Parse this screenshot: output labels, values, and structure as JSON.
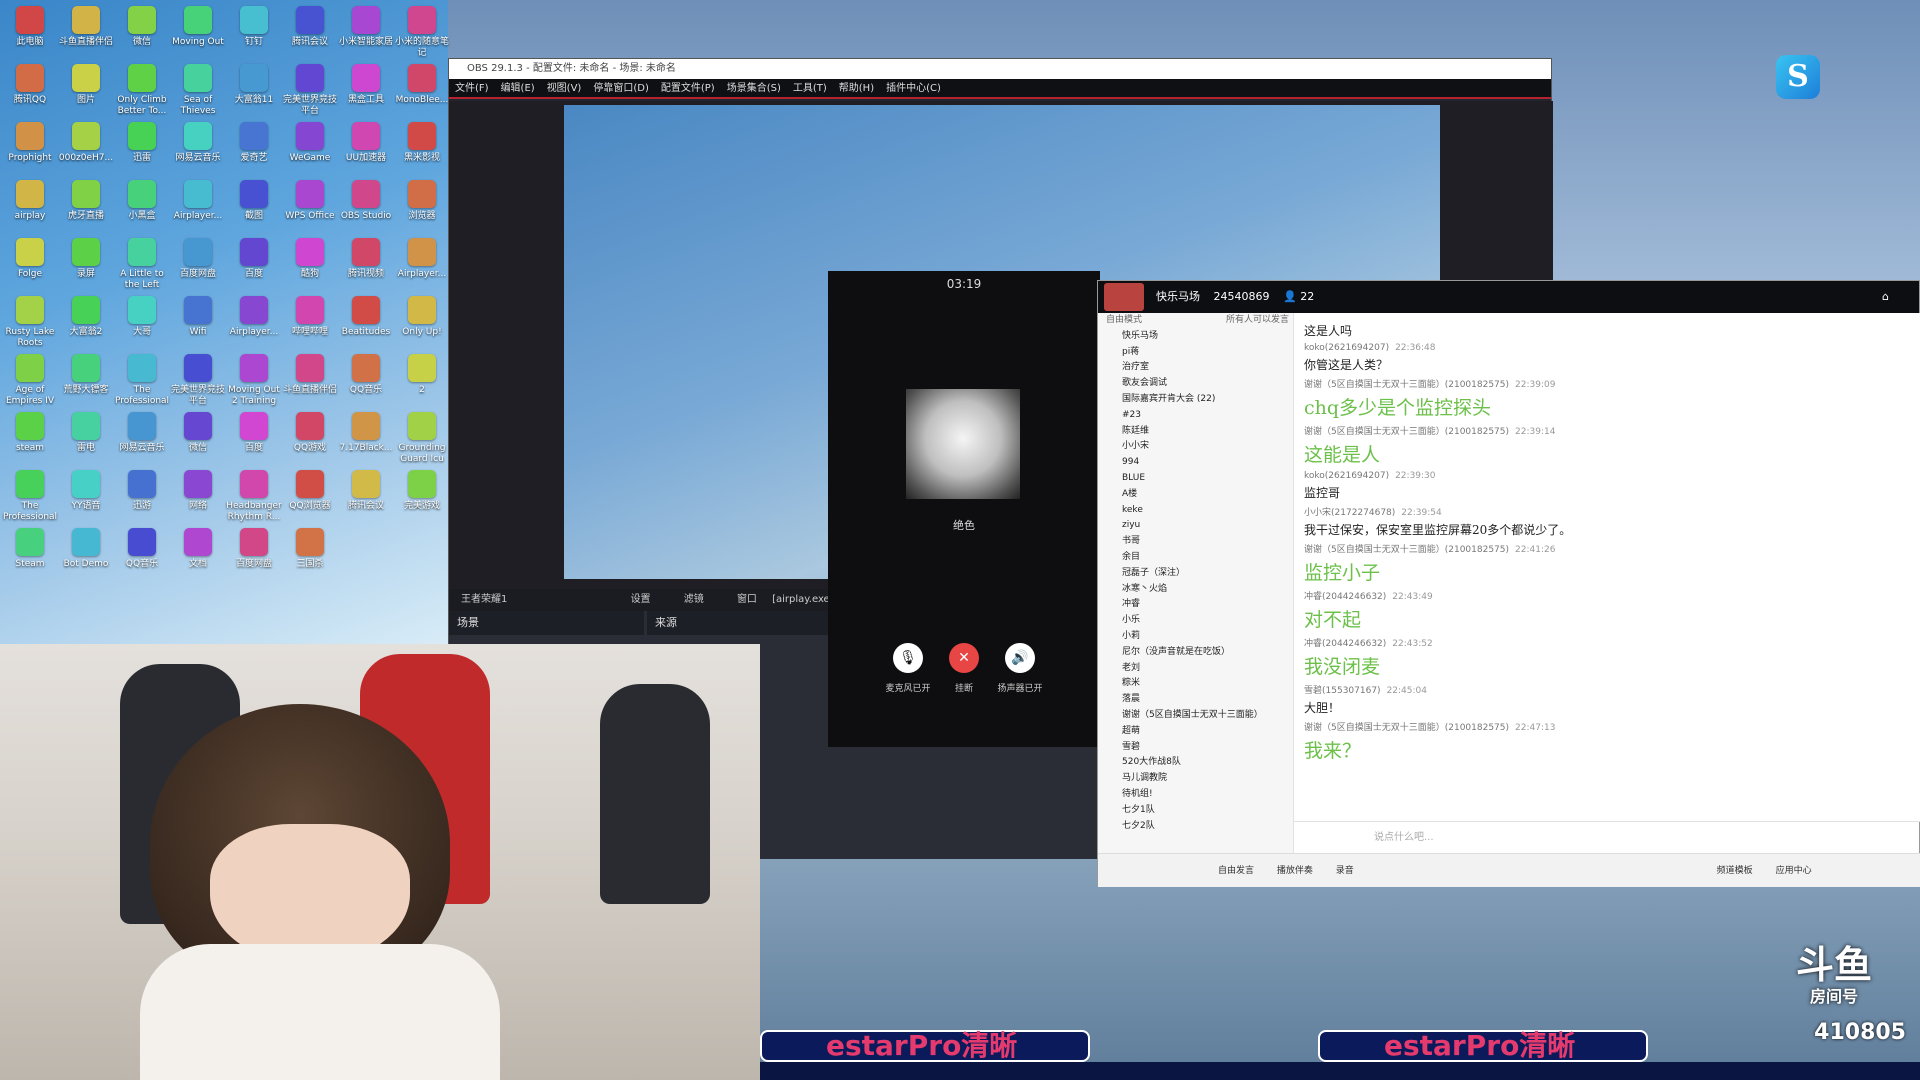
{
  "desktop": {
    "icons": [
      "此电脑",
      "斗鱼直播伴侣",
      "微信",
      "Moving Out",
      "钉钉",
      "腾讯会议",
      "小米智能家居",
      "小米的随意笔记",
      "腾讯QQ",
      "图片",
      "Only Climb Better To...",
      "Sea of Thieves",
      "大富翁11",
      "完美世界竞技平台",
      "黑盒工具",
      "MonoBlee...",
      "Prophight",
      "000z0eH7...",
      "迅雷",
      "网易云音乐",
      "爱奇艺",
      "WeGame",
      "UU加速器",
      "黑米影视",
      "airplay",
      "虎牙直播",
      "小黑盒",
      "Airplayer...",
      "截图",
      "WPS Office",
      "OBS Studio",
      "浏览器",
      "Folge",
      "录屏",
      "A Little to the Left",
      "百度网盘",
      "百度",
      "酷狗",
      "腾讯视频",
      "Airplayer...",
      "Rusty Lake Roots",
      "大富翁2",
      "大哥",
      "Wifi",
      "Airplayer...",
      "哔哩哔哩",
      "Beatitudes",
      "Only Up!",
      "Age of Empires IV",
      "荒野大镖客",
      "The Professional",
      "完美世界竞技平台",
      "Moving Out 2 Training",
      "斗鱼直播伴侣",
      "QQ音乐",
      "2",
      "steam",
      "雷电",
      "网易云音乐",
      "微信",
      "百度",
      "QQ游戏",
      "7.17Black...",
      "Grounding Guard Icu",
      "The Professional",
      "YY语音",
      "迅游",
      "网络",
      "Headbanger Rhythm R...",
      "QQ浏览器",
      "腾讯会议",
      "完美游戏",
      "Steam",
      "Bot Demo",
      "QQ音乐",
      "文档",
      "百度网盘",
      "三国杀"
    ]
  },
  "obs": {
    "title": "OBS 29.1.3 - 配置文件: 未命名 - 场景: 未命名",
    "menu": [
      "文件(F)",
      "编辑(E)",
      "视图(V)",
      "停靠窗口(D)",
      "配置文件(P)",
      "场景集合(S)",
      "工具(T)",
      "帮助(H)",
      "插件中心(C)"
    ],
    "toolbar": {
      "source": "王者荣耀1",
      "settings": "设置",
      "filters": "滤镜",
      "window": "窗口",
      "window_value": "[airplay.exe]: [noname]"
    },
    "docks": {
      "scenes": "场景",
      "sources": "来源"
    }
  },
  "call": {
    "timer": "03:19",
    "name": "绝色",
    "buttons": [
      {
        "label": "麦克风已开",
        "icon": "🎙"
      },
      {
        "label": "挂断",
        "icon": "✕"
      },
      {
        "label": "扬声器已开",
        "icon": "🔊"
      }
    ]
  },
  "yy": {
    "header": {
      "channel": "快乐马场",
      "id": "24540869",
      "members": "22"
    },
    "left": {
      "mode": "自由模式",
      "mode_hint": "所有人可以发言",
      "groups": [
        "快乐马场",
        "pi蒋",
        "治疗室",
        "歌友会调试",
        "国际嘉宾开肯大会 (22)",
        "#23",
        "陈廷维",
        "小小宋",
        "994",
        "BLUE",
        "A楼",
        "keke",
        "ziyu",
        "书哥",
        "余目",
        "冠磊子（深注）",
        "冰寒丶火焰",
        "冲睿",
        "小乐",
        "小莉",
        "尼尔（没声音就是在吃饭）",
        "老刘",
        "粽米",
        "落晨",
        "谢谢（5区自摸国士无双十三面能）",
        "超萌",
        "雪碧",
        "520大作战8队",
        "马儿调教院",
        "待机组!",
        "七夕1队",
        "七夕2队"
      ]
    },
    "messages": [
      {
        "meta_name": "",
        "meta_time": "",
        "text": "这是人吗",
        "big": false
      },
      {
        "meta_name": "koko(2621694207)",
        "meta_time": "22:36:48",
        "text": "你管这是人类？",
        "big": false
      },
      {
        "meta_name": "谢谢（5区自摸国士无双十三面能）(2100182575)",
        "meta_time": "22:39:09",
        "text": "chq多少是个监控探头",
        "big": true
      },
      {
        "meta_name": "谢谢（5区自摸国士无双十三面能）(2100182575)",
        "meta_time": "22:39:14",
        "text": "这能是人",
        "big": true
      },
      {
        "meta_name": "koko(2621694207)",
        "meta_time": "22:39:30",
        "text": "监控哥",
        "big": false
      },
      {
        "meta_name": "小小宋(2172274678)",
        "meta_time": "22:39:54",
        "text": "我干过保安，保安室里监控屏幕20多个都说少了。",
        "big": false
      },
      {
        "meta_name": "谢谢（5区自摸国士无双十三面能）(2100182575)",
        "meta_time": "22:41:26",
        "text": "监控小子",
        "big": true
      },
      {
        "meta_name": "冲睿(2044246632)",
        "meta_time": "22:43:49",
        "text": "对不起",
        "big": true
      },
      {
        "meta_name": "冲睿(2044246632)",
        "meta_time": "22:43:52",
        "text": "我没闭麦",
        "big": true
      },
      {
        "meta_name": "雪碧(155307167)",
        "meta_time": "22:45:04",
        "text": "大胆！",
        "big": false
      },
      {
        "meta_name": "谢谢（5区自摸国士无双十三面能）(2100182575)",
        "meta_time": "22:47:13",
        "text": "我来？",
        "big": true
      }
    ],
    "input_placeholder": "说点什么吧...",
    "bottom": {
      "free_speak": "自由发言",
      "play_music": "播放伴奏",
      "record": "录音",
      "channel_template": "频道模板",
      "apps": "应用中心"
    }
  },
  "overlay": {
    "banner_text": "estarPro清晰",
    "douyu_logo": "斗鱼",
    "room_label": "房间号",
    "room_id": "410805"
  }
}
